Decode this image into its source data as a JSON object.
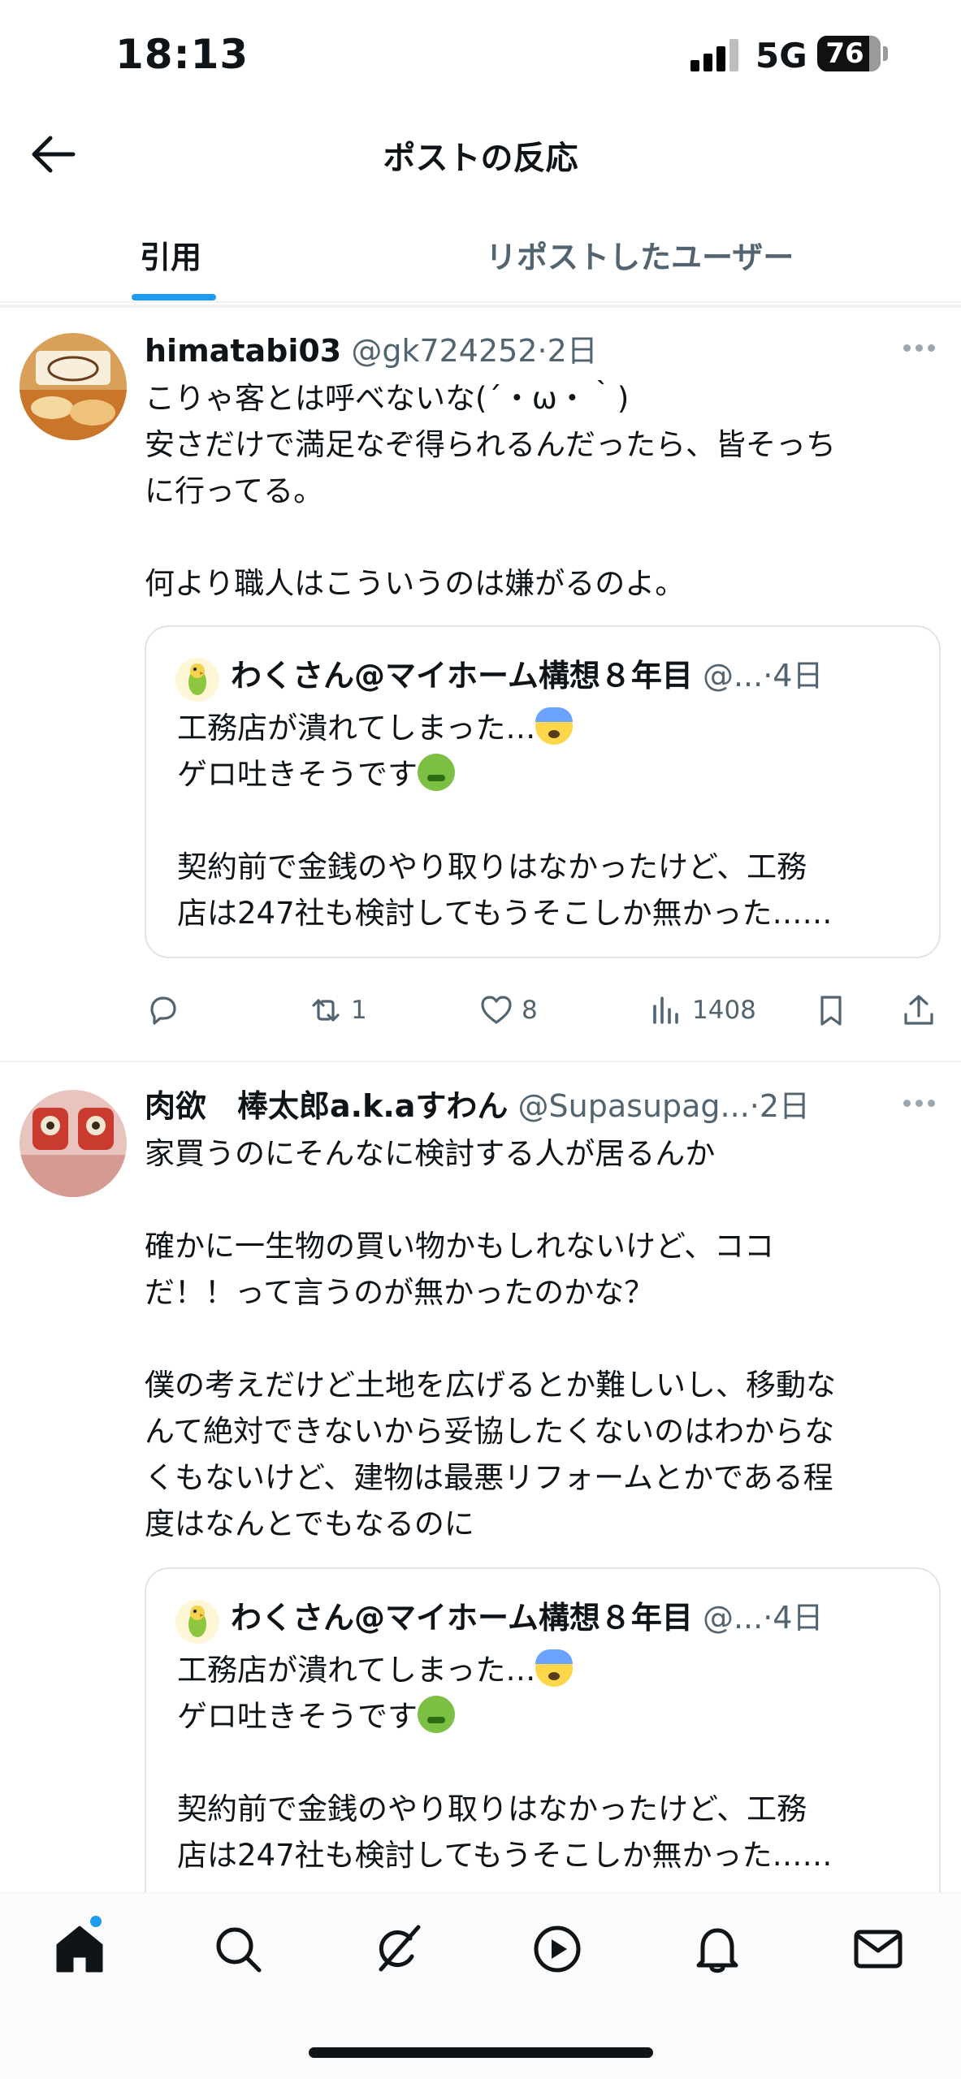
{
  "status_bar": {
    "time": "18:13",
    "network": "5G",
    "battery": "76"
  },
  "header": {
    "title": "ポストの反応"
  },
  "tabs": [
    {
      "label": "引用",
      "active": true
    },
    {
      "label": "リポストしたユーザー",
      "active": false
    }
  ],
  "posts": [
    {
      "author_name": "himatabi03",
      "handle": "@gk724252",
      "time": "·2日",
      "text": "こりゃ客とは呼べないな(´・ω・｀)\n安さだけで満足なぞ得られるんだったら、皆そっち\nに行ってる。\n\n何より職人はこういうのは嫌がるのよ。",
      "quote": {
        "author_name": "わくさん@マイホーム構想８年目",
        "handle": "@...",
        "time": "·4日",
        "line1": "工務店が潰れてしまった…",
        "line2": "ゲロ吐きそうです",
        "line3": "契約前で金銭のやり取りはなかったけど、工務\n店は247社も検討してもうそこしか無かった……"
      },
      "actions": {
        "replies": "",
        "reposts": "1",
        "likes": "8",
        "views": "1408"
      }
    },
    {
      "author_name": "肉欲　棒太郎a.k.aすわん",
      "handle": "@Supasupag...",
      "time": "·2日",
      "text": "家買うのにそんなに検討する人が居るんか\n\n確かに一生物の買い物かもしれないけど、ココ\nだ！！って言うのが無かったのかな？\n\n僕の考えだけど土地を広げるとか難しいし、移動な\nんて絶対できないから妥協したくないのはわからな\nくもないけど、建物は最悪リフォームとかである程\n度はなんとでもなるのに",
      "quote": {
        "author_name": "わくさん@マイホーム構想８年目",
        "handle": "@...",
        "time": "·4日",
        "line1": "工務店が潰れてしまった…",
        "line2": "ゲロ吐きそうです",
        "line3": "契約前で金銭のやり取りはなかったけど、工務\n店は247社も検討してもうそこしか無かった……"
      }
    }
  ],
  "bottom_nav": [
    {
      "icon": "home-icon",
      "active": true
    },
    {
      "icon": "search-icon"
    },
    {
      "icon": "grok-icon"
    },
    {
      "icon": "play-icon"
    },
    {
      "icon": "bell-icon"
    },
    {
      "icon": "mail-icon"
    }
  ],
  "colors": {
    "accent": "#1d9bf0",
    "text": "#0f1419",
    "secondary": "#536471",
    "divider": "#eff3f4"
  }
}
